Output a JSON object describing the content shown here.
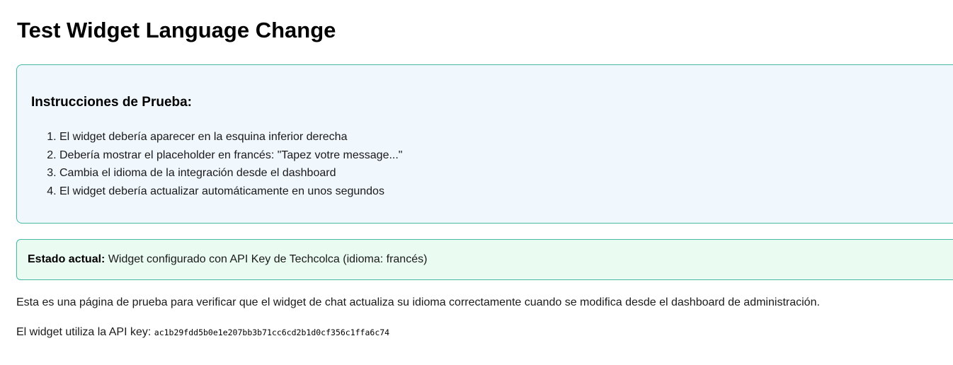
{
  "page": {
    "title": "Test Widget Language Change"
  },
  "instructions": {
    "title": "Instrucciones de Prueba:",
    "items": [
      "El widget debería aparecer en la esquina inferior derecha",
      "Debería mostrar el placeholder en francés: \"Tapez votre message...\"",
      "Cambia el idioma de la integración desde el dashboard",
      "El widget debería actualizar automáticamente en unos segundos"
    ]
  },
  "status": {
    "label": "Estado actual:",
    "text": "Widget configurado con API Key de Techcolca (idioma: francés)"
  },
  "description": "Esta es una página de prueba para verificar que el widget de chat actualiza su idioma correctamente cuando se modifica desde el dashboard de administración.",
  "api": {
    "label": "El widget utiliza la API key:",
    "key": "ac1b29fdd5b0e1e207bb3b71cc6cd2b1d0cf356c1ffa6c74"
  },
  "colors": {
    "instructions_bg": "#f0f7fd",
    "status_bg": "#eafbf1",
    "border_accent": "#46b8a4"
  }
}
